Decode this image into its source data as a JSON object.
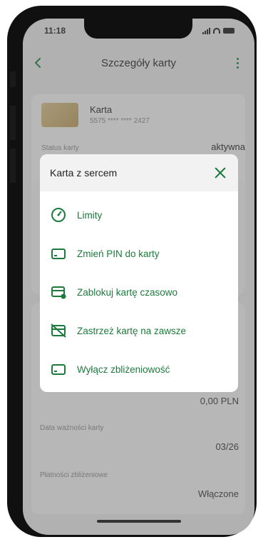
{
  "status_bar": {
    "time": "11:18"
  },
  "header": {
    "title": "Szczegóły karty",
    "back_icon": "chevron-left-icon",
    "menu_icon": "more-vertical-icon"
  },
  "card": {
    "name": "Karta",
    "number": "5575 **** **** 2427",
    "status_label": "Status karty",
    "status_value": "aktywna"
  },
  "details": [
    {
      "label": "",
      "value": "0,00 PLN"
    },
    {
      "label": "Data ważności karty",
      "value": "03/26"
    },
    {
      "label": "Płatności zbliżeniowe",
      "value": "Włączone"
    }
  ],
  "modal": {
    "title": "Karta z sercem",
    "close_icon": "close-icon",
    "items": [
      {
        "label": "Limity",
        "icon": "gauge-icon"
      },
      {
        "label": "Zmień PIN do karty",
        "icon": "card-icon"
      },
      {
        "label": "Zablokuj kartę czasowo",
        "icon": "card-lock-icon"
      },
      {
        "label": "Zastrzeż kartę na zawsze",
        "icon": "card-crossed-icon"
      },
      {
        "label": "Wyłącz zbliżeniowość",
        "icon": "card-icon"
      }
    ]
  },
  "colors": {
    "accent": "#1c7a3c",
    "overlay": "#646464",
    "modal_header": "#f2f2f2"
  }
}
